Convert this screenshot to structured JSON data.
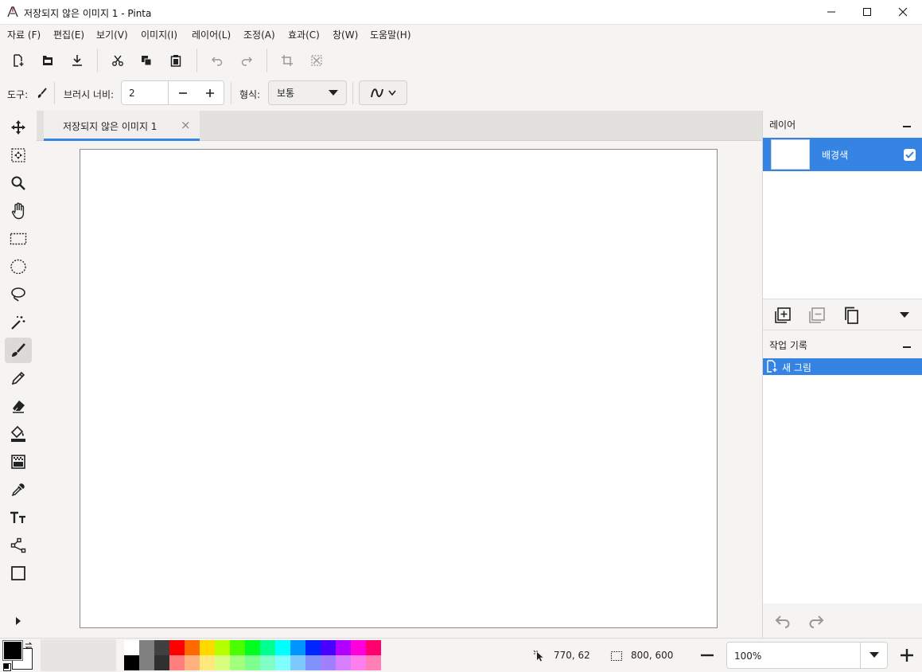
{
  "window": {
    "title": "저장되지 않은 이미지 1 - Pinta",
    "controls": [
      "minimize",
      "maximize",
      "close"
    ]
  },
  "menu": [
    {
      "label": "자료 (F)"
    },
    {
      "label": "편집(E)"
    },
    {
      "label": "보기(V)"
    },
    {
      "label": "이미지(I)"
    },
    {
      "label": "레이어(L)"
    },
    {
      "label": "조정(A)"
    },
    {
      "label": "효과(C)"
    },
    {
      "label": "창(W)"
    },
    {
      "label": "도움말(H)"
    }
  ],
  "toolbar": {
    "icons": [
      "new-file-icon",
      "open-file-icon",
      "save-icon",
      "cut-icon",
      "copy-icon",
      "paste-icon",
      "undo-icon",
      "redo-icon",
      "crop-icon",
      "deselect-icon"
    ]
  },
  "options": {
    "tool_label": "도구:",
    "brush_width_label": "브러시 너비:",
    "brush_width_value": "2",
    "type_label": "형식:",
    "type_value": "보통"
  },
  "document": {
    "tab_title": "저장되지 않은 이미지 1",
    "tab_close": "×"
  },
  "layers": {
    "title": "레이어",
    "items": [
      {
        "name": "배경색",
        "visible": true,
        "selected": true
      }
    ]
  },
  "history": {
    "title": "작업 기록",
    "items": [
      {
        "label": "새 그림",
        "selected": true
      }
    ]
  },
  "status": {
    "cursor_position": "770, 62",
    "selection_size": "800, 600",
    "zoom": "100%"
  },
  "palette": {
    "primary": "#000000",
    "secondary": "#ffffff",
    "top_row": [
      "#ffffff",
      "#808080",
      "#404040",
      "#ff0000",
      "#ff6a00",
      "#ffd800",
      "#b6ff00",
      "#4cff00",
      "#00ff21",
      "#00ff90",
      "#00ffff",
      "#0094ff",
      "#0026ff",
      "#4800ff",
      "#b200ff",
      "#ff00dc",
      "#ff006e"
    ],
    "bottom_row": [
      "#000000",
      "#808080",
      "#303030",
      "#ff7f7f",
      "#ffb27f",
      "#ffe97f",
      "#daff7f",
      "#a5ff7f",
      "#7fff8e",
      "#7fffc5",
      "#7fffff",
      "#7fc9ff",
      "#7f92ff",
      "#a17fff",
      "#d67fff",
      "#ff7fed",
      "#ff7fb6"
    ]
  },
  "colors": {
    "accent": "#3584e4",
    "selection_bg": "#3584e4"
  }
}
